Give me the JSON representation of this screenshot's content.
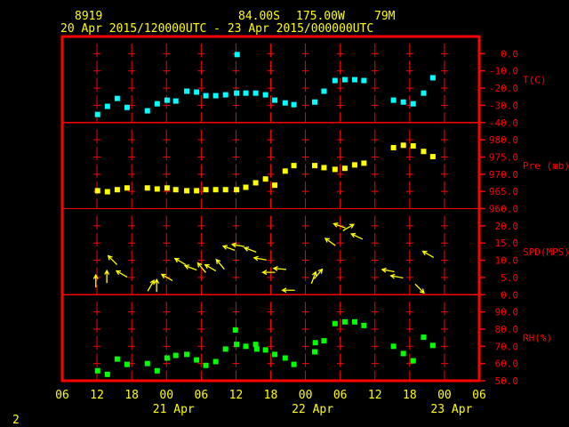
{
  "header": {
    "station": "8919",
    "lat": "84.00S",
    "lon": "175.00W",
    "elev": "79M",
    "period": "20 Apr 2015/120000UTC - 23 Apr 2015/000000UTC"
  },
  "footer": {
    "page": "2"
  },
  "colors": {
    "frame": "#ff0000",
    "temp": "#00ffff",
    "pres": "#ffff00",
    "wind": "#ffff00",
    "rh": "#00ff00",
    "text": "#ffff00",
    "axis_text": "#ff0000"
  },
  "chart_data": {
    "type": "scatter",
    "time_unit": "hours since 20 Apr 06 UTC",
    "xlim": [
      0,
      72
    ],
    "x_ticks": [
      "06",
      "12",
      "18",
      "00",
      "06",
      "12",
      "18",
      "00",
      "06",
      "12",
      "18",
      "00",
      "06"
    ],
    "x_dates": [
      {
        "label": "21 Apr",
        "hour": 18
      },
      {
        "label": "22 Apr",
        "hour": 42
      },
      {
        "label": "23 Apr",
        "hour": 66
      }
    ],
    "panels": [
      {
        "name": "temperature",
        "label": "T(C)",
        "ylim": [
          -40,
          0
        ],
        "ticks": [
          "0.0",
          "-10.0",
          "-20.0",
          "-30.0",
          "-40.0"
        ],
        "color": "#00ffff",
        "points": [
          [
            6.1,
            -35.3
          ],
          [
            7.8,
            -30.6
          ],
          [
            9.5,
            -26.0
          ],
          [
            11.2,
            -31.2
          ],
          [
            14.7,
            -33.2
          ],
          [
            16.4,
            -29.1
          ],
          [
            18.1,
            -27.0
          ],
          [
            19.6,
            -27.5
          ],
          [
            21.5,
            -21.8
          ],
          [
            23.2,
            -22.3
          ],
          [
            24.8,
            -24.4
          ],
          [
            26.5,
            -24.4
          ],
          [
            28.2,
            -23.9
          ],
          [
            30.2,
            -0.5
          ],
          [
            30.1,
            -22.9
          ],
          [
            31.7,
            -22.9
          ],
          [
            33.4,
            -22.9
          ],
          [
            35.1,
            -23.9
          ],
          [
            36.7,
            -27.0
          ],
          [
            38.5,
            -28.6
          ],
          [
            40.0,
            -29.6
          ],
          [
            43.6,
            -28.1
          ],
          [
            45.2,
            -21.8
          ],
          [
            47.1,
            -15.6
          ],
          [
            48.8,
            -15.1
          ],
          [
            50.5,
            -15.1
          ],
          [
            52.1,
            -15.6
          ],
          [
            57.2,
            -27.0
          ],
          [
            58.9,
            -28.1
          ],
          [
            60.6,
            -29.1
          ],
          [
            62.4,
            -22.9
          ],
          [
            64.0,
            -14.0
          ]
        ]
      },
      {
        "name": "pressure",
        "label": "Pre (mb)",
        "ylim": [
          960,
          980
        ],
        "ticks": [
          "980.0",
          "975.0",
          "970.0",
          "965.0",
          "960.0"
        ],
        "color": "#ffff00",
        "points": [
          [
            6.1,
            965.2
          ],
          [
            7.8,
            964.9
          ],
          [
            9.5,
            965.5
          ],
          [
            11.2,
            966.0
          ],
          [
            14.7,
            966.0
          ],
          [
            16.4,
            965.7
          ],
          [
            18.1,
            966.0
          ],
          [
            19.6,
            965.5
          ],
          [
            21.5,
            965.2
          ],
          [
            23.2,
            965.2
          ],
          [
            24.8,
            965.5
          ],
          [
            26.5,
            965.5
          ],
          [
            28.2,
            965.5
          ],
          [
            30.1,
            965.5
          ],
          [
            31.7,
            966.2
          ],
          [
            33.4,
            967.5
          ],
          [
            35.1,
            968.6
          ],
          [
            36.7,
            966.8
          ],
          [
            38.5,
            970.9
          ],
          [
            40.0,
            972.5
          ],
          [
            43.6,
            972.5
          ],
          [
            45.2,
            971.9
          ],
          [
            47.1,
            971.4
          ],
          [
            48.8,
            971.7
          ],
          [
            50.5,
            972.7
          ],
          [
            52.1,
            973.2
          ],
          [
            57.2,
            977.7
          ],
          [
            58.9,
            978.4
          ],
          [
            60.6,
            978.2
          ],
          [
            62.4,
            976.6
          ],
          [
            64.0,
            975.1
          ]
        ]
      },
      {
        "name": "wind",
        "label": "SPD(MPS)",
        "ylim": [
          0,
          20
        ],
        "ticks": [
          "20.0",
          "15.0",
          "10.0",
          "5.0",
          "0.0"
        ],
        "color": "#ffff00",
        "arrows": [
          [
            5.8,
            3.9,
            0
          ],
          [
            7.7,
            5.2,
            0
          ],
          [
            8.7,
            10.0,
            315
          ],
          [
            10.3,
            6.0,
            300
          ],
          [
            15.3,
            2.6,
            30
          ],
          [
            16.3,
            2.6,
            0
          ],
          [
            18.1,
            5.0,
            300
          ],
          [
            20.4,
            9.6,
            300
          ],
          [
            22.2,
            7.8,
            290
          ],
          [
            24.1,
            7.8,
            320
          ],
          [
            25.6,
            7.8,
            300
          ],
          [
            27.3,
            8.8,
            320
          ],
          [
            28.8,
            13.5,
            290
          ],
          [
            30.4,
            14.3,
            280
          ],
          [
            32.5,
            13.0,
            290
          ],
          [
            34.2,
            10.4,
            280
          ],
          [
            35.7,
            6.5,
            270
          ],
          [
            37.6,
            7.5,
            275
          ],
          [
            39.1,
            1.3,
            270
          ],
          [
            43.4,
            4.9,
            20
          ],
          [
            44.2,
            6.0,
            40
          ],
          [
            46.3,
            15.3,
            305
          ],
          [
            47.9,
            20.0,
            290
          ],
          [
            49.4,
            19.5,
            60
          ],
          [
            50.9,
            16.9,
            295
          ],
          [
            56.3,
            7.0,
            280
          ],
          [
            57.8,
            5.2,
            280
          ],
          [
            61.7,
            1.8,
            135
          ],
          [
            63.2,
            11.7,
            300
          ]
        ]
      },
      {
        "name": "humidity",
        "label": "RH(%)",
        "ylim": [
          50,
          90
        ],
        "ticks": [
          "90.0",
          "80.0",
          "70.0",
          "60.0",
          "50.0"
        ],
        "color": "#00ff00",
        "points": [
          [
            6.1,
            55.8
          ],
          [
            7.8,
            53.7
          ],
          [
            9.5,
            62.6
          ],
          [
            11.2,
            59.5
          ],
          [
            14.7,
            60.0
          ],
          [
            16.4,
            55.8
          ],
          [
            18.1,
            63.2
          ],
          [
            19.6,
            64.7
          ],
          [
            21.5,
            65.3
          ],
          [
            23.2,
            62.1
          ],
          [
            24.8,
            58.9
          ],
          [
            26.5,
            61.1
          ],
          [
            28.2,
            68.4
          ],
          [
            29.9,
            79.5
          ],
          [
            30.1,
            71.1
          ],
          [
            31.7,
            70.0
          ],
          [
            33.4,
            71.1
          ],
          [
            33.6,
            68.4
          ],
          [
            35.1,
            67.9
          ],
          [
            36.7,
            65.3
          ],
          [
            38.5,
            63.2
          ],
          [
            40.0,
            59.5
          ],
          [
            43.6,
            66.8
          ],
          [
            43.7,
            72.1
          ],
          [
            45.2,
            73.2
          ],
          [
            47.1,
            83.2
          ],
          [
            48.8,
            84.2
          ],
          [
            50.5,
            84.2
          ],
          [
            52.1,
            82.1
          ],
          [
            57.2,
            70.0
          ],
          [
            58.9,
            65.8
          ],
          [
            60.6,
            61.6
          ],
          [
            62.4,
            75.3
          ],
          [
            64.0,
            70.5
          ]
        ]
      }
    ]
  }
}
